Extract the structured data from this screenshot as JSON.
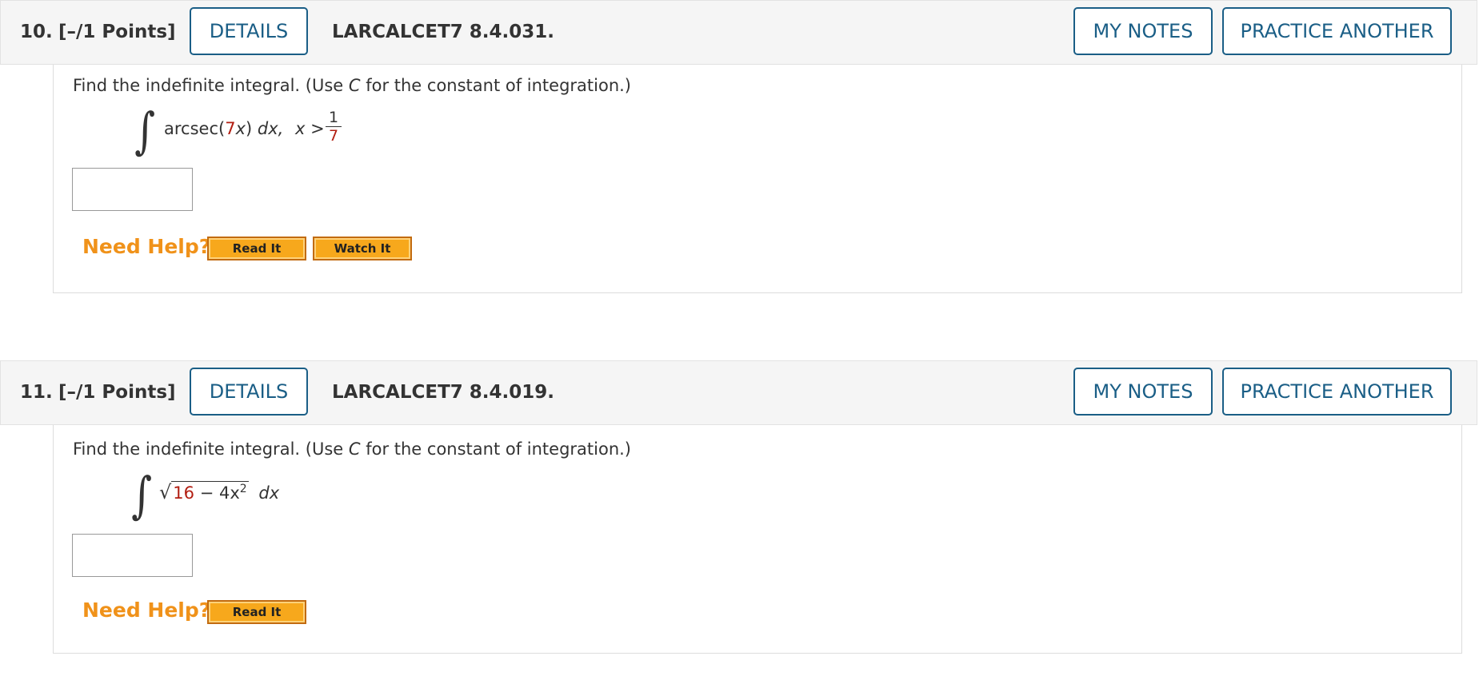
{
  "questions": [
    {
      "number": "10.",
      "points": "[–/1 Points]",
      "details_label": "DETAILS",
      "code": "LARCALCET7 8.4.031.",
      "my_notes_label": "MY NOTES",
      "practice_label": "PRACTICE ANOTHER",
      "prompt_pre": "Find the indefinite integral. (Use ",
      "prompt_var": "C",
      "prompt_post": " for the constant of integration.)",
      "integrand_func": "arcsec(",
      "integrand_coef": "7",
      "integrand_var": "x",
      "integrand_close": ")",
      "differential": "dx,",
      "condition_lhs": "x >",
      "condition_num": "1",
      "condition_den": "7",
      "answer_value": "",
      "need_help_label": "Need Help?",
      "help_buttons": [
        "Read It",
        "Watch It"
      ]
    },
    {
      "number": "11.",
      "points": "[–/1 Points]",
      "details_label": "DETAILS",
      "code": "LARCALCET7 8.4.019.",
      "my_notes_label": "MY NOTES",
      "practice_label": "PRACTICE ANOTHER",
      "prompt_pre": "Find the indefinite integral. (Use ",
      "prompt_var": "C",
      "prompt_post": " for the constant of integration.)",
      "radicand_const": "16",
      "radicand_rest": " − 4x",
      "radicand_exp": "2",
      "differential": "dx",
      "answer_value": "",
      "need_help_label": "Need Help?",
      "help_buttons": [
        "Read It"
      ]
    }
  ],
  "colors": {
    "button_border": "#1a5e86",
    "header_bg": "#f5f5f5",
    "need_help": "#f0921a",
    "help_button_bg": "#f7a81c",
    "math_highlight": "#b21e12"
  }
}
